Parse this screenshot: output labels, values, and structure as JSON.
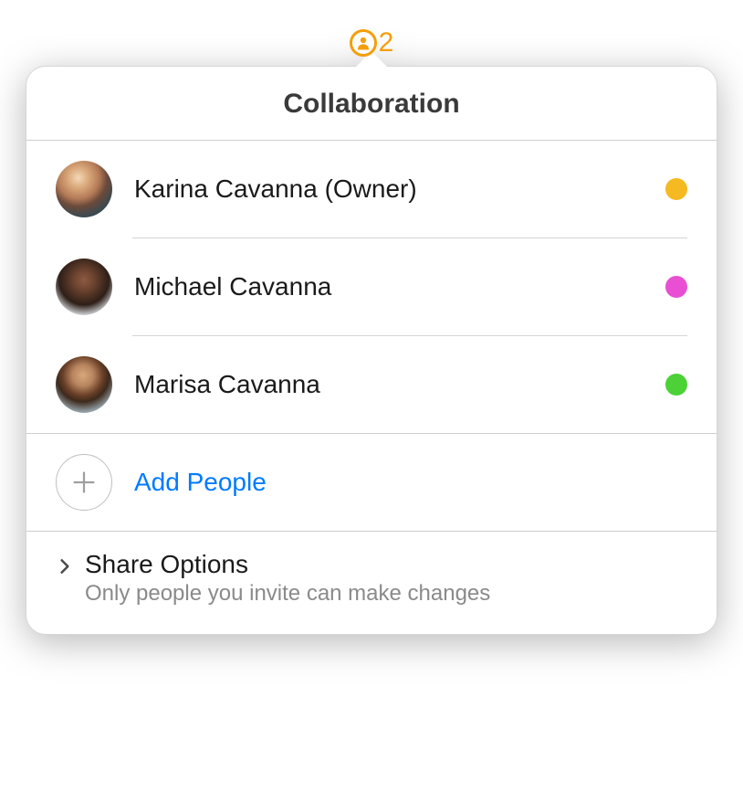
{
  "badge": {
    "count": "2",
    "icon_name": "person-silhouette-icon",
    "accent_color": "#f59e0b"
  },
  "popover": {
    "title": "Collaboration",
    "people": [
      {
        "name": "Karina Cavanna (Owner)",
        "status_color": "#f5b921"
      },
      {
        "name": "Michael Cavanna",
        "status_color": "#e84fd3"
      },
      {
        "name": "Marisa Cavanna",
        "status_color": "#4cd137"
      }
    ],
    "add_people": {
      "label": "Add People",
      "link_color": "#007aff"
    },
    "share_options": {
      "title": "Share Options",
      "subtitle": "Only people you invite can make changes"
    }
  }
}
